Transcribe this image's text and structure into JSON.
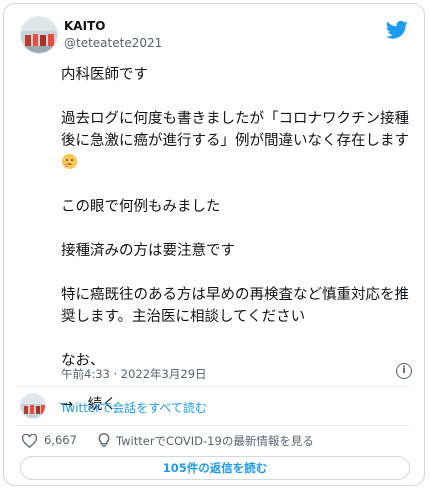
{
  "author": {
    "name": "KAITO",
    "handle": "@teteatete2021",
    "avatar_icon": "avatar-image",
    "brand_icon": "twitter-bird-icon",
    "brand_color": "#1d9bf0"
  },
  "tweet": {
    "p1": "内科医師です",
    "p2": "過去ログに何度も書きましたが「コロナワクチン接種後に急激に癌が進行する」例が間違いなく存在します",
    "p2_emoji": "thinking-face-emoji",
    "p3": "この眼で何例もみました",
    "p4": "接種済みの方は要注意です",
    "p5": "特に癌既往のある方は早めの再検査など慎重対応を推奨します。主治医に相談してください",
    "p6": "なお、",
    "p7": "→　続く",
    "timestamp": "午前4:33 · 2022年3月29日",
    "info_icon": "info-icon"
  },
  "conversation": {
    "link": "Twitterで会話をすべて読む"
  },
  "actions": {
    "like_count": "6,667",
    "covid_info": "TwitterでCOVID-19の最新情報を見る",
    "heart_icon": "heart-icon",
    "lightbulb_icon": "lightbulb-icon"
  },
  "replies_button": "105件の返信を読む",
  "accent_color": "#1d9bf0",
  "muted_color": "#536471"
}
